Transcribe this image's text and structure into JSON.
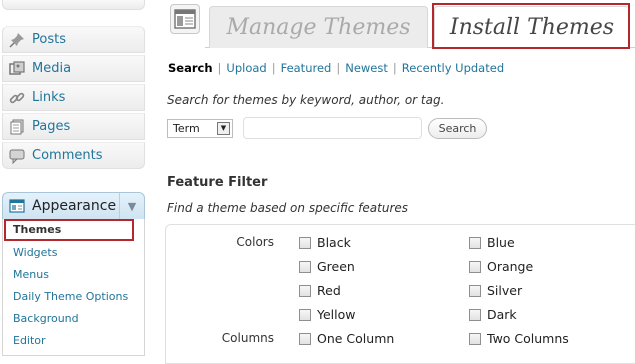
{
  "sidebar": {
    "items": [
      {
        "label": "Posts",
        "icon": "pushpin-icon"
      },
      {
        "label": "Media",
        "icon": "media-icon"
      },
      {
        "label": "Links",
        "icon": "link-icon"
      },
      {
        "label": "Pages",
        "icon": "pages-icon"
      },
      {
        "label": "Comments",
        "icon": "comment-icon"
      }
    ],
    "appearance": {
      "label": "Appearance",
      "icon": "appearance-icon"
    },
    "submenu": [
      "Themes",
      "Widgets",
      "Menus",
      "Daily Theme Options",
      "Background",
      "Editor"
    ],
    "current_submenu": "Themes"
  },
  "header": {
    "icon": "themes-icon",
    "tabs": [
      {
        "label": "Manage Themes",
        "active": false
      },
      {
        "label": "Install Themes",
        "active": true
      }
    ]
  },
  "subnav": {
    "links": [
      "Search",
      "Upload",
      "Featured",
      "Newest",
      "Recently Updated"
    ],
    "current": "Search"
  },
  "search": {
    "description": "Search for themes by keyword, author, or tag.",
    "type_selected": "Term",
    "input_value": "",
    "button_label": "Search"
  },
  "feature_filter": {
    "title": "Feature Filter",
    "description": "Find a theme based on specific features",
    "groups": [
      {
        "label": "Colors",
        "options": [
          "Black",
          "Blue",
          "Green",
          "Orange",
          "Red",
          "Silver",
          "Yellow",
          "Dark"
        ]
      },
      {
        "label": "Columns",
        "options": [
          "One Column",
          "Two Columns"
        ]
      }
    ]
  },
  "colors": {
    "link": "#21759b",
    "highlight": "#b3282d"
  }
}
